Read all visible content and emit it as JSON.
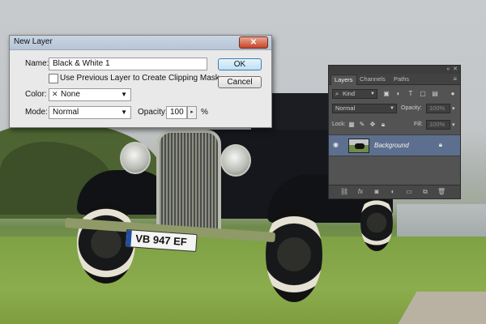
{
  "photo": {
    "plate_text": "VB 947 EF"
  },
  "dialog": {
    "title": "New Layer",
    "close_glyph": "✕",
    "name_label": "Name:",
    "name_value": "Black & White 1",
    "clip_label": "Use Previous Layer to Create Clipping Mask",
    "clip_checked": false,
    "color_label": "Color:",
    "color_value": "None",
    "mode_label": "Mode:",
    "mode_value": "Normal",
    "opacity_label": "Opacity:",
    "opacity_value": "100",
    "opacity_unit": "%",
    "ok_label": "OK",
    "cancel_label": "Cancel"
  },
  "layers_panel": {
    "tabs": [
      "Layers",
      "Channels",
      "Paths"
    ],
    "active_tab": "Layers",
    "filter_value": "Kind",
    "blend_mode": "Normal",
    "opacity_label": "Opacity:",
    "opacity_value": "100%",
    "lock_label": "Lock:",
    "fill_label": "Fill:",
    "fill_value": "100%",
    "layers": [
      {
        "name": "Background",
        "visible": true,
        "locked": true,
        "selected": true
      }
    ],
    "bottom_icons": [
      "link-icon",
      "fx-icon",
      "mask-icon",
      "adjustment-icon",
      "folder-icon",
      "new-layer-icon",
      "trash-icon"
    ]
  },
  "colors": {
    "panel_bg": "#535353",
    "selected_layer": "#5c6f8e",
    "ok_button": "#bee0f5"
  }
}
